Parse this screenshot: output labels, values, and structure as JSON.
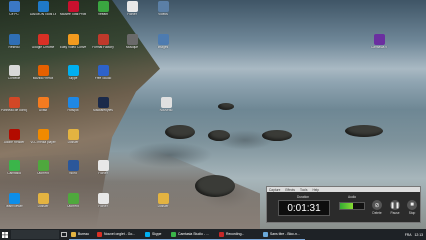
{
  "desktop_icons": [
    {
      "label": "Ce PC",
      "icon": "computer-icon",
      "color": "#3b78c4",
      "col": 0,
      "row": 0
    },
    {
      "label": "DAEMON Tools Lite",
      "icon": "daemon-tools-icon",
      "color": "#1f79c9",
      "col": 1,
      "row": 0
    },
    {
      "label": "McAfee Total Protection",
      "icon": "mcafee-icon",
      "color": "#c8102e",
      "col": 2,
      "row": 0
    },
    {
      "label": "Veeam",
      "icon": "veeam-icon",
      "color": "#3aa640",
      "col": 3,
      "row": 0
    },
    {
      "label": "Fichier",
      "icon": "document-icon",
      "color": "#e8e8e8",
      "col": 4,
      "row": 0
    },
    {
      "label": "Vidéos",
      "icon": "video-folder-icon",
      "color": "#5b7fa6",
      "col": 5,
      "row": 0
    },
    {
      "label": "Réseau",
      "icon": "network-icon",
      "color": "#2f6fb5",
      "col": 0,
      "row": 1
    },
    {
      "label": "Google Chrome",
      "icon": "chrome-icon",
      "color": "#d93025",
      "col": 1,
      "row": 1
    },
    {
      "label": "Easy Video Converter",
      "icon": "video-converter-icon",
      "color": "#f39a1e",
      "col": 2,
      "row": 1
    },
    {
      "label": "Format Factory",
      "icon": "format-factory-icon",
      "color": "#c0392b",
      "col": 3,
      "row": 1
    },
    {
      "label": "Musique",
      "icon": "music-folder-icon",
      "color": "#6a6a6a",
      "col": 4,
      "row": 1
    },
    {
      "label": "Images",
      "icon": "pictures-folder-icon",
      "color": "#4d7bb0",
      "col": 5,
      "row": 1
    },
    {
      "label": "Corbeille",
      "icon": "recycle-bin-icon",
      "color": "#d8d8d8",
      "col": 0,
      "row": 2
    },
    {
      "label": "Mozilla Firefox",
      "icon": "firefox-icon",
      "color": "#e66000",
      "col": 1,
      "row": 2
    },
    {
      "label": "Skype",
      "icon": "skype-icon",
      "color": "#00aff0",
      "col": 2,
      "row": 2
    },
    {
      "label": "Free Studio",
      "icon": "free-studio-icon",
      "color": "#2d62c9",
      "col": 3,
      "row": 2
    },
    {
      "label": "Panneau de configuration",
      "icon": "control-panel-icon",
      "color": "#d24726",
      "col": 0,
      "row": 3
    },
    {
      "label": "Avast",
      "icon": "avast-icon",
      "color": "#f47b20",
      "col": 1,
      "row": 3
    },
    {
      "label": "Hotspot",
      "icon": "wifi-icon",
      "color": "#1e88e5",
      "col": 2,
      "row": 3
    },
    {
      "label": "Malwarebytes",
      "icon": "malwarebytes-icon",
      "color": "#1b2a4a",
      "col": 3,
      "row": 3
    },
    {
      "label": "Adobe Reader",
      "icon": "adobe-reader-icon",
      "color": "#b30b00",
      "col": 0,
      "row": 4
    },
    {
      "label": "VLC media player",
      "icon": "vlc-icon",
      "color": "#f08a00",
      "col": 1,
      "row": 4
    },
    {
      "label": "Dossier",
      "icon": "folder-icon",
      "color": "#e3b341",
      "col": 2,
      "row": 4
    },
    {
      "label": "Camtasia",
      "icon": "camtasia-icon",
      "color": "#3bb54a",
      "col": 0,
      "row": 5
    },
    {
      "label": "Utorrent",
      "icon": "utorrent-icon",
      "color": "#4fa83d",
      "col": 1,
      "row": 5
    },
    {
      "label": "Word",
      "icon": "word-icon",
      "color": "#2b579a",
      "col": 2,
      "row": 5
    },
    {
      "label": "Fichier",
      "icon": "document-icon",
      "color": "#e8e8e8",
      "col": 3,
      "row": 5
    },
    {
      "label": "TeamViewer",
      "icon": "teamviewer-icon",
      "color": "#0e8ee9",
      "col": 0,
      "row": 6
    },
    {
      "label": "Dossier",
      "icon": "folder-icon",
      "color": "#e3b341",
      "col": 1,
      "row": 6
    },
    {
      "label": "Utorrent",
      "icon": "utorrent-icon",
      "color": "#4fa83d",
      "col": 2,
      "row": 6
    },
    {
      "label": "Fichier",
      "icon": "document-icon",
      "color": "#e8e8e8",
      "col": 3,
      "row": 6
    },
    {
      "label": "Dossier",
      "icon": "folder-icon",
      "color": "#e3b341",
      "col": 5,
      "row": 6
    }
  ],
  "extra_icons": [
    {
      "label": "Camtasia 9",
      "icon": "camtasia-file-icon",
      "color": "#6b2fa0"
    },
    {
      "label": "Nouveau",
      "icon": "file-icon",
      "color": "#e0e0e0"
    }
  ],
  "taskbar": {
    "search_placeholder": "",
    "apps": [
      {
        "label": "Bureau",
        "icon": "folder-icon",
        "color": "#e3b341"
      },
      {
        "label": "Nouvel onglet - Go...",
        "icon": "chrome-icon",
        "color": "#d93025"
      },
      {
        "label": "Skype",
        "icon": "skype-icon",
        "color": "#00aff0"
      },
      {
        "label": "Camtasia Studio - ...",
        "icon": "camtasia-icon",
        "color": "#3bb54a"
      },
      {
        "label": "Recording...",
        "icon": "record-icon",
        "color": "#c62828"
      },
      {
        "label": "Sans titre - Bloc-n...",
        "icon": "notepad-icon",
        "color": "#6aa8d8"
      }
    ],
    "tray_lang": "FRA",
    "tray_time": "12:13"
  },
  "recorder": {
    "menu": [
      "Capture",
      "Effects",
      "Tools",
      "Help"
    ],
    "duration_label": "Duration",
    "time": "0:01:31",
    "audio_label": "Audio",
    "audio_level": 0.55,
    "buttons": [
      {
        "label": "Delete",
        "icon": "delete-icon",
        "symbol": "⊘"
      },
      {
        "label": "Pause",
        "icon": "pause-icon",
        "symbol": "❚❚"
      },
      {
        "label": "Stop",
        "icon": "stop-icon",
        "symbol": "■"
      }
    ]
  }
}
